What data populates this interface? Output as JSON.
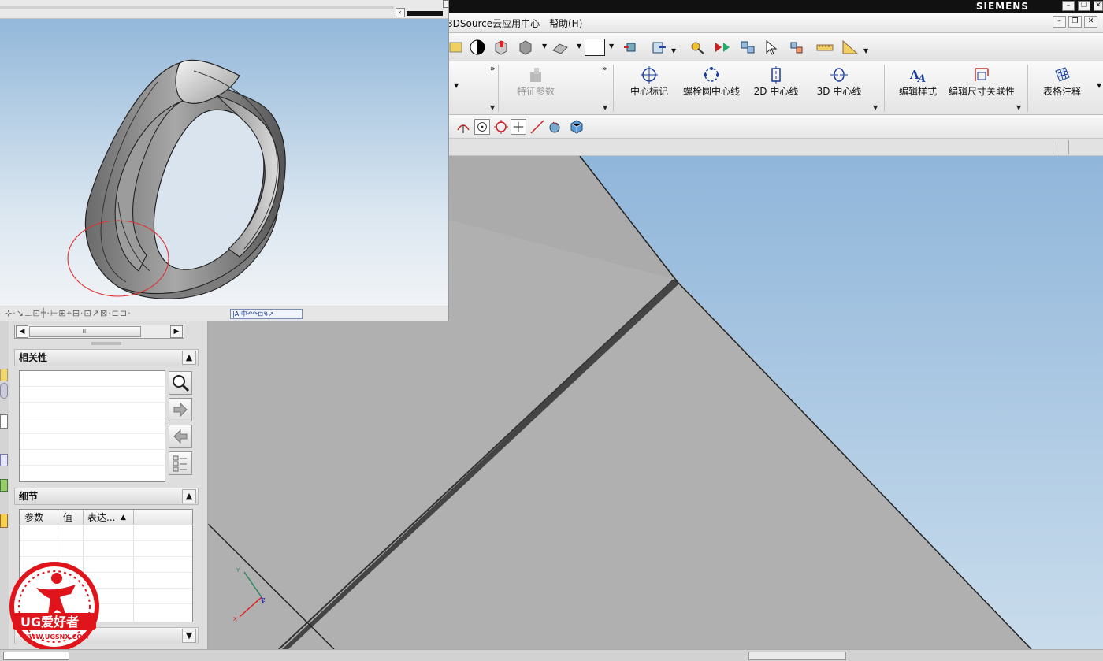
{
  "window": {
    "brand": "SIEMENS"
  },
  "menu": {
    "items": [
      "3DSource云应用中心",
      "帮助(H)"
    ]
  },
  "ribbon": {
    "disabled_item": "特征参数",
    "groups": [
      {
        "label": "中心标记"
      },
      {
        "label": "螺栓圆中心线"
      },
      {
        "label": "2D 中心线"
      },
      {
        "label": "3D 中心线"
      },
      {
        "label": "编辑样式"
      },
      {
        "label": "编辑尺寸关联性"
      },
      {
        "label": "表格注释"
      }
    ]
  },
  "panels": {
    "dependencies": {
      "title": "相关性"
    },
    "details": {
      "title": "细节",
      "columns": [
        "参数",
        "值",
        "表达..."
      ]
    }
  },
  "icons": {
    "search": "magnifier-icon",
    "forward": "arrow-right-icon",
    "back": "arrow-left-icon",
    "tree": "tree-list-icon"
  },
  "watermark": {
    "brand": "UG爱好者",
    "url": "WWW.UGSNX.COM"
  },
  "colors": {
    "accent": "#1a3a9a",
    "logo_red": "#e0141b",
    "title_bar": "#111111"
  }
}
